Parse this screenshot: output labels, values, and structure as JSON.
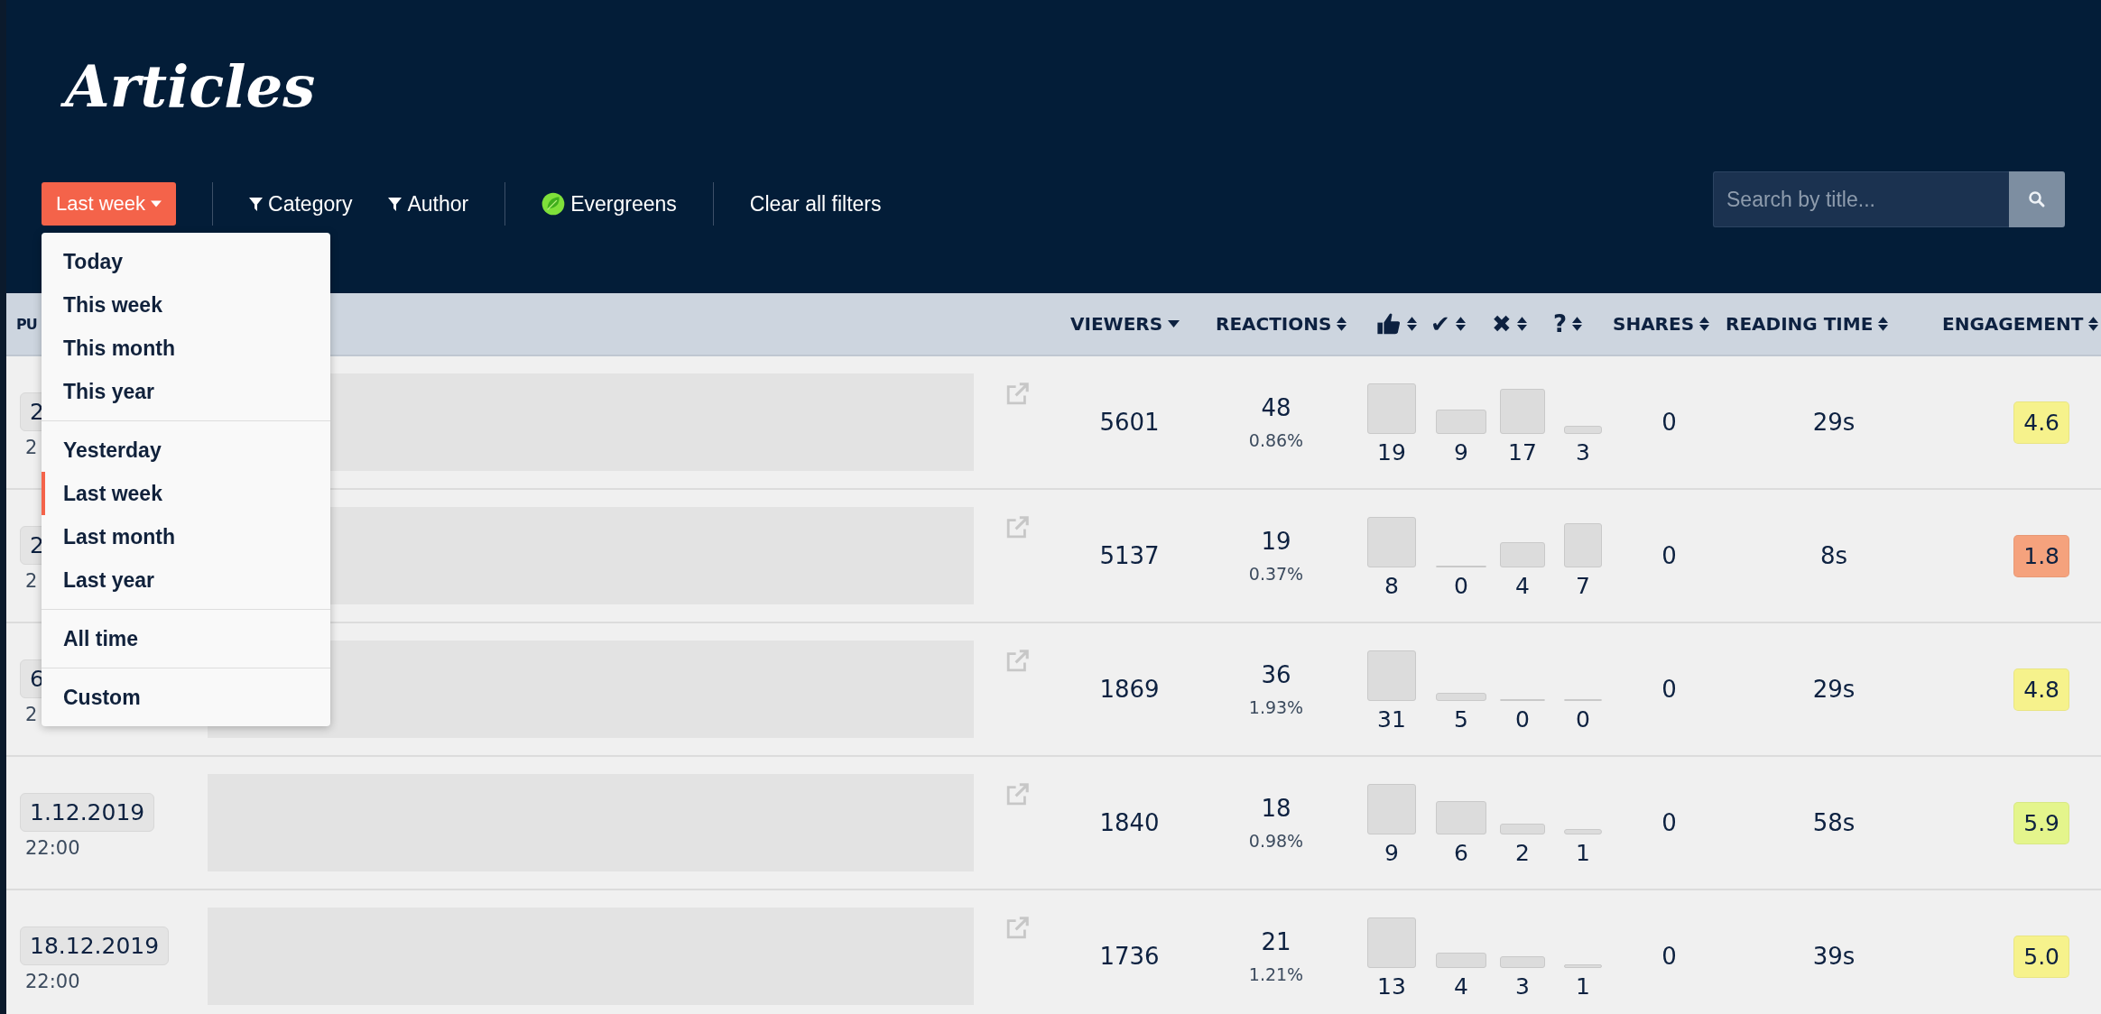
{
  "title": "Articles",
  "toolbar": {
    "period_button": "Last week",
    "category_filter": "Category",
    "author_filter": "Author",
    "evergreens": "Evergreens",
    "clear": "Clear all filters"
  },
  "search": {
    "placeholder": "Search by title..."
  },
  "period_menu": [
    {
      "items": [
        {
          "label": "Today",
          "selected": false
        },
        {
          "label": "This week",
          "selected": false
        },
        {
          "label": "This month",
          "selected": false
        },
        {
          "label": "This year",
          "selected": false
        }
      ]
    },
    {
      "items": [
        {
          "label": "Yesterday",
          "selected": false
        },
        {
          "label": "Last week",
          "selected": true
        },
        {
          "label": "Last month",
          "selected": false
        },
        {
          "label": "Last year",
          "selected": false
        }
      ]
    },
    {
      "items": [
        {
          "label": "All time",
          "selected": false
        }
      ]
    },
    {
      "items": [
        {
          "label": "Custom",
          "selected": false
        }
      ]
    }
  ],
  "columns": [
    {
      "kind": "text",
      "label": "PU"
    },
    {
      "kind": "text",
      "label": "VIEWERS",
      "sortable": true,
      "sorted": true
    },
    {
      "kind": "text",
      "label": "REACTIONS",
      "sortable": true,
      "sorted": false
    },
    {
      "kind": "icon",
      "sortable": true,
      "sorted": false
    },
    {
      "kind": "glyph",
      "label": "✔",
      "sortable": true,
      "sorted": false
    },
    {
      "kind": "glyph",
      "label": "✖",
      "sortable": true,
      "sorted": false
    },
    {
      "kind": "glyph",
      "label": "?",
      "sortable": true,
      "sorted": false
    },
    {
      "kind": "text",
      "label": "SHARES",
      "sortable": true,
      "sorted": false
    },
    {
      "kind": "text",
      "label": "READING TIME",
      "sortable": true,
      "sorted": false
    },
    {
      "kind": "text",
      "label": "ENGAGEMENT",
      "sortable": true,
      "sorted": false
    }
  ],
  "rows": [
    {
      "date": "2",
      "time": "2",
      "viewers": "5601",
      "reactions": "48",
      "rate": "0.86%",
      "counts": [
        "19",
        "9",
        "17",
        "3"
      ],
      "shares": "0",
      "reading_time": "29s",
      "engagement": "4.6",
      "color": "#f6f28c"
    },
    {
      "date": "2",
      "time": "2",
      "viewers": "5137",
      "reactions": "19",
      "rate": "0.37%",
      "counts": [
        "8",
        "0",
        "4",
        "7"
      ],
      "shares": "0",
      "reading_time": "8s",
      "engagement": "1.8",
      "color": "#f5a27d"
    },
    {
      "date": "6",
      "time": "2",
      "viewers": "1869",
      "reactions": "36",
      "rate": "1.93%",
      "counts": [
        "31",
        "5",
        "0",
        "0"
      ],
      "shares": "0",
      "reading_time": "29s",
      "engagement": "4.8",
      "color": "#f6f28c"
    },
    {
      "date": "1.12.2019",
      "time": "22:00",
      "viewers": "1840",
      "reactions": "18",
      "rate": "0.98%",
      "counts": [
        "9",
        "6",
        "2",
        "1"
      ],
      "shares": "0",
      "reading_time": "58s",
      "engagement": "5.9",
      "color": "#e4f58c"
    },
    {
      "date": "18.12.2019",
      "time": "22:00",
      "viewers": "1736",
      "reactions": "21",
      "rate": "1.21%",
      "counts": [
        "13",
        "4",
        "3",
        "1"
      ],
      "shares": "0",
      "reading_time": "39s",
      "engagement": "5.0",
      "color": "#f6f28c"
    }
  ]
}
